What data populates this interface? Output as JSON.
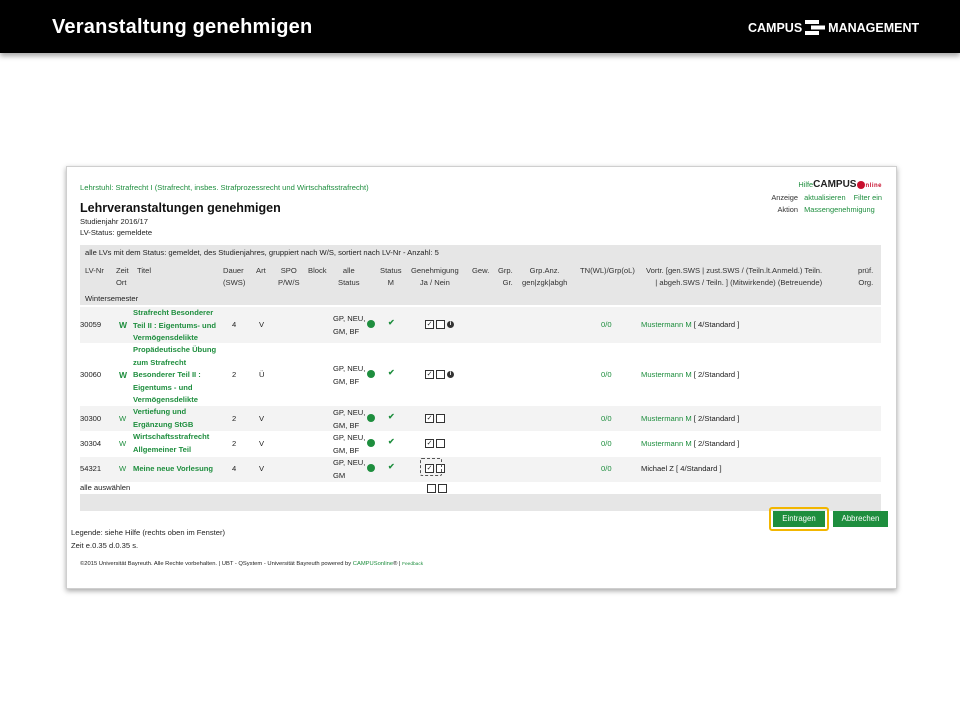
{
  "slide": {
    "title": "Veranstaltung genehmigen",
    "brand": "CAMPUS MANAGEMENT"
  },
  "panel": {
    "chair": "Lehrstuhl: Strafrecht I (Strafrecht, insbes. Strafprozessrecht und Wirtschaftsstrafrecht)",
    "heading": "Lehrveranstaltungen genehmigen",
    "studienjahr": "Studienjahr 2016/17",
    "lv_status": "LV-Status: gemeldete",
    "help": {
      "hilfe": "Hilfe",
      "brand": "CAMPUS",
      "online": "nline"
    },
    "anzeige": {
      "label": "Anzeige",
      "link1": "aktualisieren",
      "link2": "Filter ein"
    },
    "aktion": {
      "label": "Aktion",
      "link": "Massengenehmigung"
    },
    "summary": "alle LVs mit dem Status: gemeldet, des Studienjahres, gruppiert nach W/S, sortiert nach LV-Nr - Anzahl: 5",
    "headers": {
      "lvnr": "LV-Nr",
      "zeit": "Zeit",
      "ort": "Ort",
      "titel": "Titel",
      "dauer1": "Dauer",
      "dauer2": "(SWS)",
      "art": "Art",
      "spo1": "SPO",
      "spo2": "P/W/S",
      "block": "Block",
      "alle1": "alle",
      "alle2": "Status",
      "status1": "Status",
      "status2": "M",
      "gen1": "Genehmigung",
      "gen2": "Ja / Nein",
      "gew": "Gew.",
      "grp1": "Grp.",
      "grp2": "Gr.",
      "grpanz1": "Grp.Anz.",
      "grpanz2": "gen|zgk|abgh",
      "tn": "TN(WL)/Grp(oL)",
      "vortr1": "Vortr. [gen.SWS | zust.SWS / (Teiln.lt.Anmeld.) Teiln.",
      "vortr2": "| abgeh.SWS / Teiln. ] (Mitwirkende) (Betreuende)",
      "pruef1": "prüf.",
      "pruef2": "Org."
    },
    "semester": "Wintersemester",
    "rows": [
      {
        "nr": "30059",
        "zeit": "W",
        "title1": "Strafrecht Besonderer",
        "title2": "Teil II : Eigentums- und",
        "title3": "Vermögensdelikte",
        "sws": "4",
        "art": "V",
        "alle1": "GP, NEU,",
        "alle2": "GM, BF",
        "tn": "0/0",
        "vortr": "Mustermann M",
        "vortr_rest": "[ 4/Standard ]"
      },
      {
        "nr": "30060",
        "zeit": "W",
        "title1": "Propädeutische Übung",
        "title2": "zum Strafrecht",
        "title3": "Besonderer Teil II :",
        "title4": "Eigentums - und",
        "title5": "Vermögensdelikte",
        "sws": "2",
        "art": "Ü",
        "alle1": "GP, NEU,",
        "alle2": "GM, BF",
        "tn": "0/0",
        "vortr": "Mustermann M",
        "vortr_rest": "[ 2/Standard ]"
      },
      {
        "nr": "30300",
        "zeit": "W",
        "title1": "Vertiefung und",
        "title2": "Ergänzung StGB",
        "sws": "2",
        "art": "V",
        "alle1": "GP, NEU,",
        "alle2": "GM, BF",
        "tn": "0/0",
        "vortr": "Mustermann M",
        "vortr_rest": "[ 2/Standard ]"
      },
      {
        "nr": "30304",
        "zeit": "W",
        "title1": "Wirtschaftsstrafrecht",
        "title2": "Allgemeiner Teil",
        "sws": "2",
        "art": "V",
        "alle1": "GP, NEU,",
        "alle2": "GM, BF",
        "tn": "0/0",
        "vortr": "Mustermann M",
        "vortr_rest": "[ 2/Standard ]"
      },
      {
        "nr": "54321",
        "zeit": "W",
        "title1": "Meine neue Vorlesung",
        "sws": "4",
        "art": "V",
        "alle1": "GP, NEU,",
        "alle2": "GM",
        "tn": "0/0",
        "vortr": "Michael Z [ 4/Standard ]"
      }
    ],
    "select_all": "alle auswählen",
    "buttons": {
      "submit": "Eintragen",
      "cancel": "Abbrechen"
    },
    "legend": "Legende: siehe Hilfe (rechts oben im Fenster)",
    "zeit": "Zeit e.0.35 d.0.35 s.",
    "footer_text": "©2015 Universität Bayreuth. Alle Rechte vorbehalten. | UBT - QSystem - Universität Bayreuth powered by ",
    "footer_link": "CAMPUSonline",
    "footer_reg": "® | ",
    "feedback": "Feedback"
  }
}
